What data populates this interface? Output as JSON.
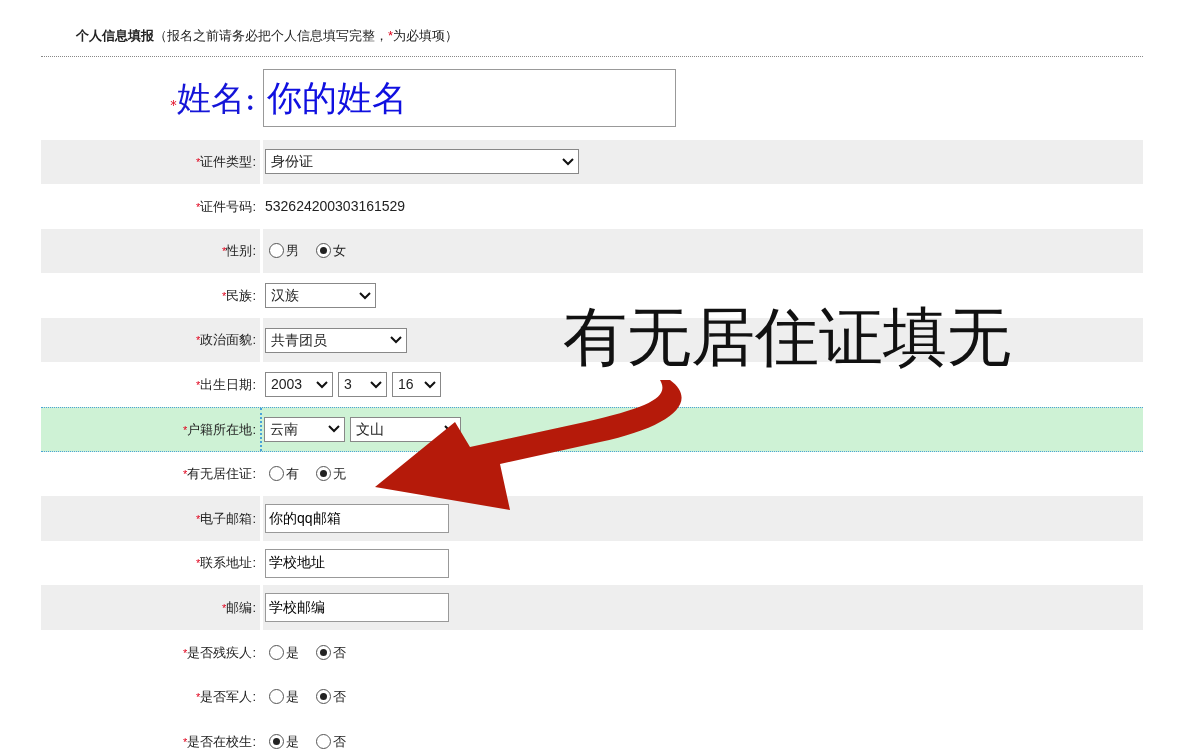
{
  "header": {
    "title": "个人信息填报",
    "note_before": "（报名之前请务必把个人信息填写完整，",
    "note_mark": "*",
    "note_after": "为必填项）"
  },
  "name_row": {
    "mark": "*",
    "label": "姓名:",
    "value": "你的姓名"
  },
  "rows": [
    {
      "mark": "*",
      "label": "证件类型:",
      "shaded": true,
      "highlighted": false,
      "kind": "select",
      "selects": [
        {
          "value": "身份证"
        }
      ]
    },
    {
      "mark": "*",
      "label": "证件号码:",
      "shaded": false,
      "highlighted": false,
      "kind": "text",
      "text": "532624200303161529"
    },
    {
      "mark": "*",
      "label": "性别:",
      "shaded": true,
      "highlighted": false,
      "kind": "radio",
      "options": [
        {
          "label": "男",
          "selected": false
        },
        {
          "label": "女",
          "selected": true
        }
      ]
    },
    {
      "mark": "*",
      "label": "民族:",
      "shaded": false,
      "highlighted": false,
      "kind": "select",
      "selects": [
        {
          "value": "汉族"
        }
      ]
    },
    {
      "mark": "*",
      "label": "政治面貌:",
      "shaded": true,
      "highlighted": false,
      "kind": "select",
      "selects": [
        {
          "value": "共青团员"
        }
      ]
    },
    {
      "mark": "*",
      "label": "出生日期:",
      "shaded": false,
      "highlighted": false,
      "kind": "select",
      "selects": [
        {
          "value": "2003"
        },
        {
          "value": "3"
        },
        {
          "value": "16"
        }
      ]
    },
    {
      "mark": "*",
      "label": "户籍所在地:",
      "shaded": false,
      "highlighted": true,
      "kind": "select",
      "selects": [
        {
          "value": "云南"
        },
        {
          "value": "文山"
        }
      ]
    },
    {
      "mark": "*",
      "label": "有无居住证:",
      "shaded": false,
      "highlighted": false,
      "kind": "radio",
      "options": [
        {
          "label": "有",
          "selected": false
        },
        {
          "label": "无",
          "selected": true
        }
      ]
    },
    {
      "mark": "*",
      "label": "电子邮箱:",
      "shaded": true,
      "highlighted": false,
      "kind": "input",
      "value": "你的qq邮箱"
    },
    {
      "mark": "*",
      "label": "联系地址:",
      "shaded": false,
      "highlighted": false,
      "kind": "input",
      "value": "学校地址"
    },
    {
      "mark": "*",
      "label": "邮编:",
      "shaded": true,
      "highlighted": false,
      "kind": "input",
      "value": "学校邮编"
    },
    {
      "mark": "*",
      "label": "是否残疾人:",
      "shaded": false,
      "highlighted": false,
      "kind": "radio",
      "options": [
        {
          "label": "是",
          "selected": false
        },
        {
          "label": "否",
          "selected": true
        }
      ]
    },
    {
      "mark": "*",
      "label": "是否军人:",
      "shaded": false,
      "highlighted": false,
      "kind": "radio",
      "options": [
        {
          "label": "是",
          "selected": false
        },
        {
          "label": "否",
          "selected": true
        }
      ]
    },
    {
      "mark": "*",
      "label": "是否在校生:",
      "shaded": false,
      "highlighted": false,
      "kind": "radio",
      "options": [
        {
          "label": "是",
          "selected": true
        },
        {
          "label": "否",
          "selected": false
        }
      ]
    }
  ],
  "annotation": {
    "text": "有无居住证填无"
  }
}
